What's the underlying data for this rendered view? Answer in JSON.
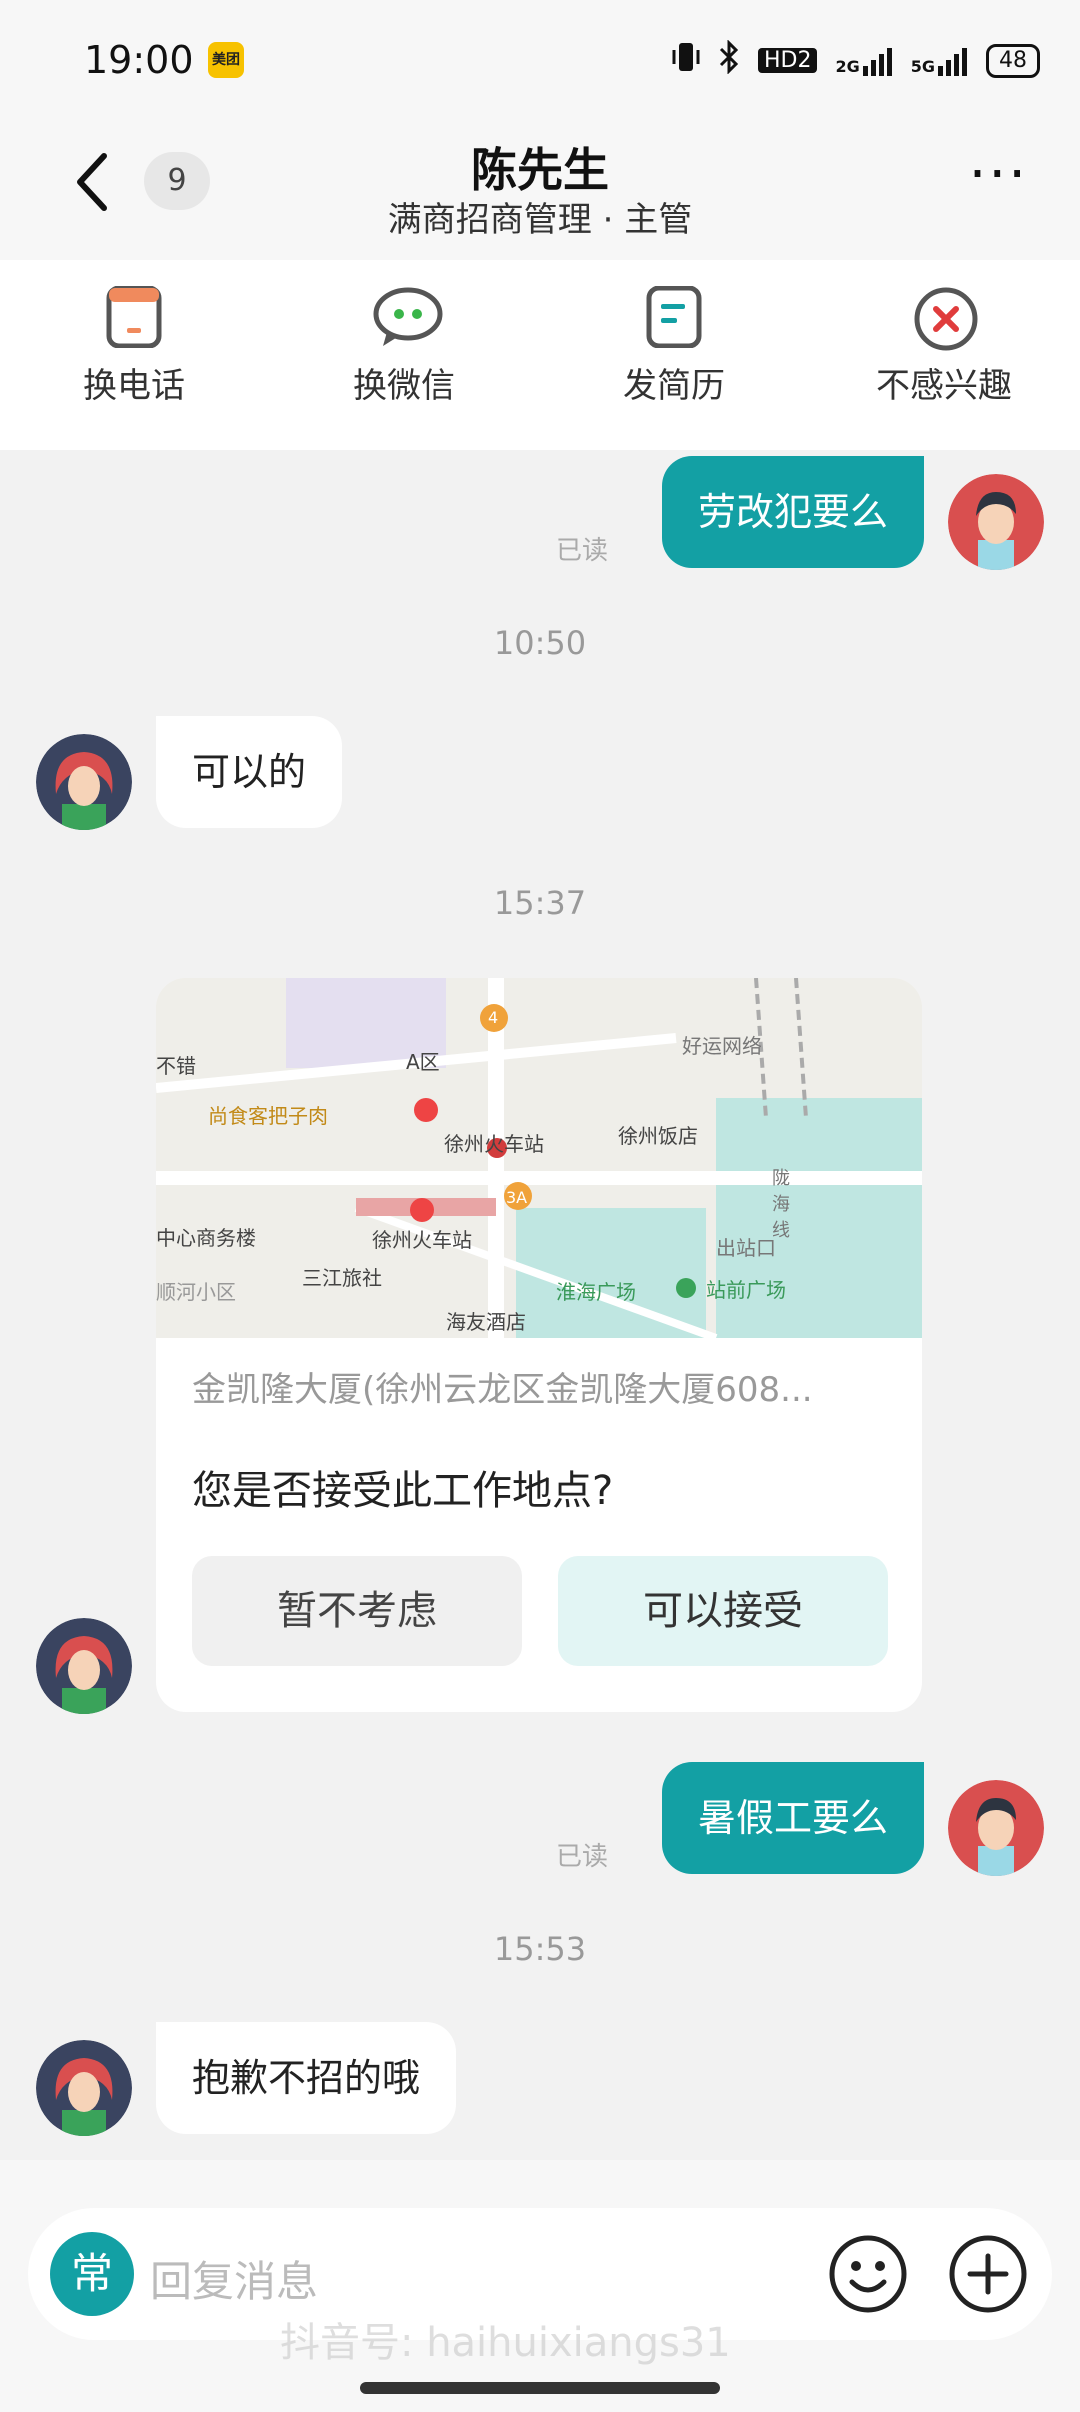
{
  "status_bar": {
    "time": "19:00",
    "app_badge": "美团",
    "hd": "HD2",
    "signal1": "2G",
    "signal2": "5G",
    "battery": "48"
  },
  "header": {
    "unread_count": "9",
    "name": "陈先生",
    "subtitle": "满商招商管理 · 主管",
    "more": "···"
  },
  "toolbar": {
    "items": [
      {
        "label": "换电话"
      },
      {
        "label": "换微信"
      },
      {
        "label": "发简历"
      },
      {
        "label": "不感兴趣"
      }
    ]
  },
  "messages": {
    "m1": {
      "text": "劳改犯要么",
      "read": "已读"
    },
    "t1": "10:50",
    "m2": {
      "text": "可以的"
    },
    "t2": "15:37",
    "card": {
      "address": "金凯隆大厦(徐州云龙区金凯隆大厦608...",
      "question": "您是否接受此工作地点?",
      "decline": "暂不考虑",
      "accept": "可以接受",
      "map_labels": [
        "A区",
        "尚食客把子肉",
        "好运网络",
        "徐州火车站",
        "徐州饭店",
        "中心商务楼",
        "徐州火车站",
        "陇海线",
        "出站口",
        "三江旅社",
        "淮海广场",
        "站前广场",
        "海友酒店",
        "顺河小区",
        "4",
        "3A",
        "不错"
      ]
    },
    "m3": {
      "text": "暑假工要么",
      "read": "已读"
    },
    "t3": "15:53",
    "m4": {
      "text": "抱歉不招的哦"
    }
  },
  "input": {
    "quick": "常",
    "placeholder": "回复消息"
  },
  "watermark": "抖音号: haihuixiangs31",
  "colors": {
    "accent": "#13a0a4",
    "accept_bg": "#e2f5f4",
    "danger": "#e03c3c"
  }
}
